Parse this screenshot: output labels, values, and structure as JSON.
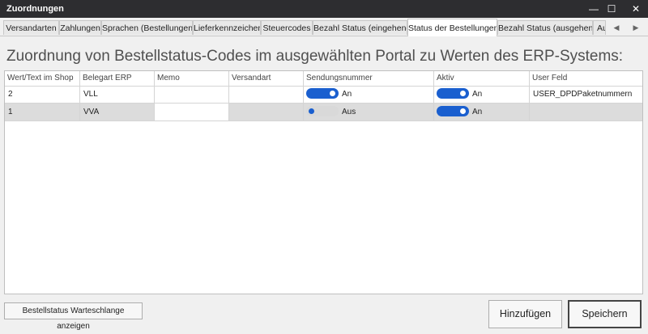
{
  "window": {
    "title": "Zuordnungen",
    "minimize": "—",
    "maximize": "☐",
    "close": "✕"
  },
  "tabs": [
    {
      "label": "Versandarten"
    },
    {
      "label": "Zahlungen"
    },
    {
      "label": "Sprachen (Bestellungen)"
    },
    {
      "label": "Lieferkennzeichen"
    },
    {
      "label": "Steuercodes"
    },
    {
      "label": "Bezahl Status (eingehend)"
    },
    {
      "label": "Status der Bestellungen"
    },
    {
      "label": "Bezahl Status (ausgehend)"
    },
    {
      "label": "Au"
    }
  ],
  "active_tab": "Status der Bestellungen",
  "tab_nav": {
    "prev": "◀",
    "next": "▶"
  },
  "heading": "Zuordnung von Bestellstatus-Codes im ausgewählten Portal zu Werten des ERP-Systems:",
  "grid": {
    "columns": [
      "Wert/Text im Shop",
      "Belegart ERP",
      "Memo",
      "Versandart",
      "Sendungsnummer",
      "Aktiv",
      "User Feld"
    ],
    "rows": [
      {
        "shop": "2",
        "erp": "VLL",
        "memo": "",
        "versandart": "",
        "sendungsnummer": "An",
        "sendungsnummer_on": true,
        "aktiv": "An",
        "aktiv_on": true,
        "user_feld": "USER_DPDPaketnummern"
      },
      {
        "shop": "1",
        "erp": "VVA",
        "memo": "",
        "versandart": "",
        "sendungsnummer": "Aus",
        "sendungsnummer_on": false,
        "aktiv": "An",
        "aktiv_on": true,
        "user_feld": ""
      }
    ]
  },
  "buttons": {
    "queue": "Bestellstatus Warteschlange anzeigen",
    "add": "Hinzufügen",
    "save": "Speichern"
  }
}
